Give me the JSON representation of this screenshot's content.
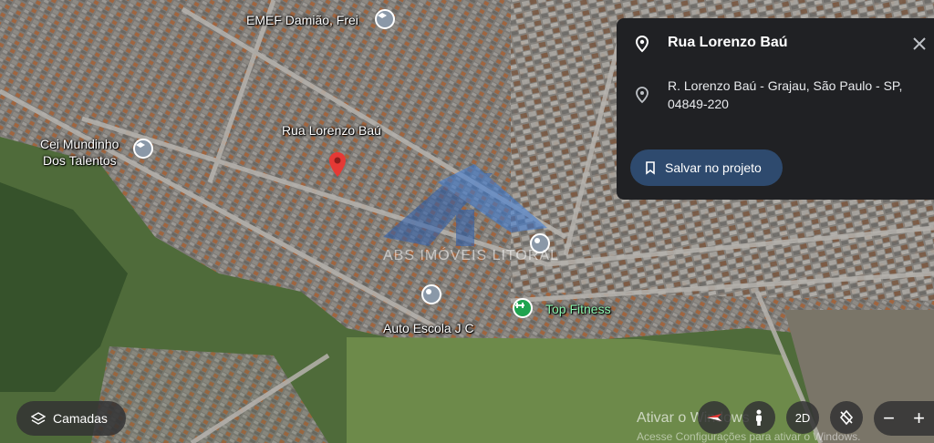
{
  "map": {
    "labels": {
      "school": "EMEF Damião, Frei",
      "street": "Rua Lorenzo Baú",
      "daycare_line1": "Cei Mundinho",
      "daycare_line2": "Dos Talentos",
      "driving_school": "Auto Escola J C",
      "gym": "Top Fitness"
    },
    "watermark": "ABS IMÓVEIS LITORAL",
    "os_notice": "Ativar o Windows",
    "os_notice_sub": "Acesse Configurações para ativar o Windows."
  },
  "panel": {
    "title": "Rua Lorenzo Baú",
    "address": "R. Lorenzo Baú - Grajau, São Paulo - SP, 04849-220",
    "save_label": "Salvar no projeto"
  },
  "controls": {
    "layers_label": "Camadas",
    "mode_label": "2D",
    "zoom_out": "−",
    "zoom_in": "+"
  },
  "colors": {
    "panel_bg": "#202124",
    "save_button_bg": "#2e4a6e",
    "marker_red": "#e53935",
    "gym_green": "#1fa34f"
  },
  "icons": [
    "location-pin-icon",
    "close-icon",
    "bookmark-icon",
    "layers-icon",
    "compass-icon",
    "street-view-person-icon",
    "rotate-icon"
  ]
}
